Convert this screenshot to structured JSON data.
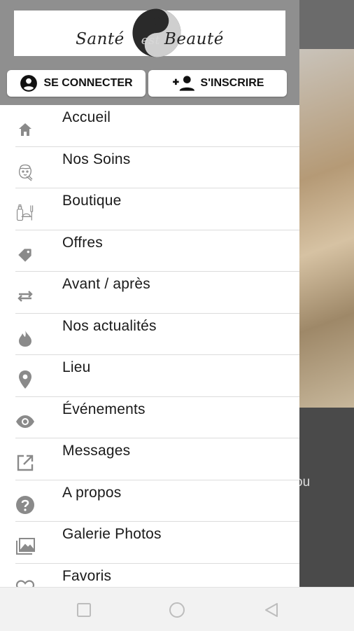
{
  "app": {
    "logo_text_left": "Santé",
    "logo_text_mid": "est",
    "logo_text_right": "Beauté"
  },
  "auth": {
    "login_label": "SE CONNECTER",
    "register_label": "S'INSCRIRE"
  },
  "menu": {
    "items": [
      {
        "label": "Accueil",
        "icon": "home-icon"
      },
      {
        "label": "Nos Soins",
        "icon": "face-care-icon"
      },
      {
        "label": "Boutique",
        "icon": "shop-icon"
      },
      {
        "label": "Offres",
        "icon": "tag-icon"
      },
      {
        "label": "Avant / après",
        "icon": "swap-icon"
      },
      {
        "label": "Nos actualités",
        "icon": "flame-icon"
      },
      {
        "label": "Lieu",
        "icon": "location-pin-icon"
      },
      {
        "label": "Événements",
        "icon": "eye-icon"
      },
      {
        "label": "Messages",
        "icon": "external-link-icon"
      },
      {
        "label": "A propos",
        "icon": "help-icon"
      },
      {
        "label": "Galerie Photos",
        "icon": "photo-gallery-icon"
      },
      {
        "label": "Favoris",
        "icon": "heart-icon"
      }
    ]
  },
  "background": {
    "partial_text": "ou"
  },
  "colors": {
    "header_bg": "#8f8f8f",
    "icon_gray": "#8a8a8a",
    "text": "#1a1a1a"
  }
}
